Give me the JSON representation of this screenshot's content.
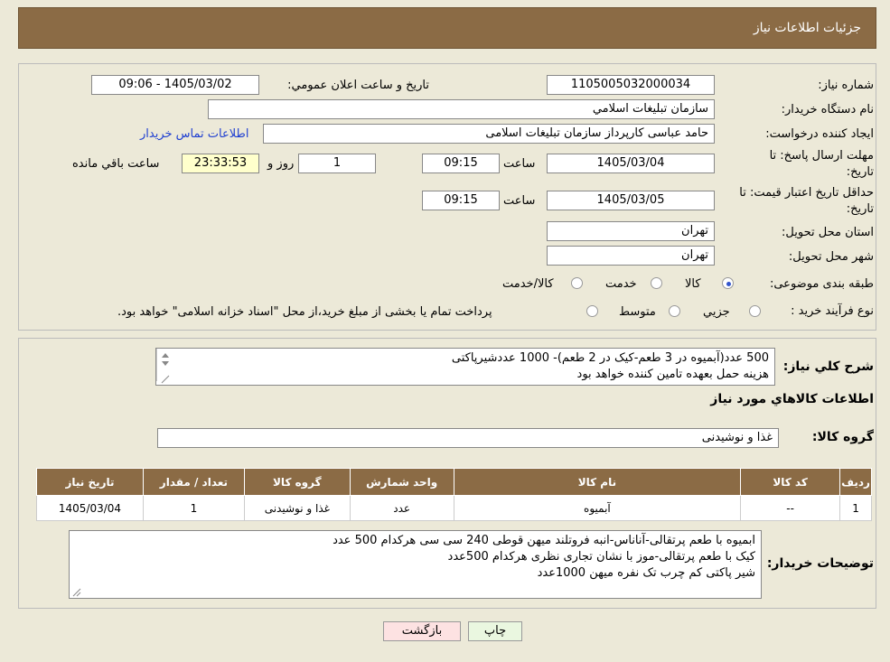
{
  "header": {
    "title": "جزئیات اطلاعات نیاز"
  },
  "fields": {
    "need_number_label": "شماره نیاز:",
    "need_number": "1105005032000034",
    "announce_label": "تاریخ و ساعت اعلان عمومي:",
    "announce_value": "1405/03/02 - 09:06",
    "buyer_label": "نام دستگاه خريدار:",
    "buyer_value": "سازمان تبليغات اسلامي",
    "creator_label": "ايجاد كننده درخواست:",
    "creator_value": "حامد عباسی کارپرداز سازمان تبلیغات اسلامی",
    "contact_link": "اطلاعات تماس خريدار",
    "deadline_label": "مهلت ارسال پاسخ: تا تاريخ:",
    "deadline_date": "1405/03/04",
    "time_label": "ساعت",
    "deadline_time": "09:15",
    "days_value": "1",
    "days_label": "روز و",
    "remaining_value": "23:33:53",
    "remaining_label": "ساعت باقي مانده",
    "validity_label": "حداقل تاريخ اعتبار قيمت: تا تاريخ:",
    "validity_date": "1405/03/05",
    "validity_time": "09:15",
    "province_label": "استان محل تحويل:",
    "province_value": "تهران",
    "city_label": "شهر محل تحويل:",
    "city_value": "تهران",
    "category_label": "طبقه بندی موضوعی:",
    "category_options": [
      "كالا",
      "خدمت",
      "كالا/خدمت"
    ],
    "process_label": "نوع فرآيند خريد :",
    "process_options": [
      "جزيي",
      "متوسط"
    ],
    "process_note": "پرداخت تمام يا بخشی از مبلغ خريد،از محل \"اسناد خزانه اسلامی\" خواهد بود."
  },
  "summary": {
    "label": "شرح كلي نياز:",
    "lines": [
      "500 عدد(آبمیوه در 3 طعم-کیک در 2 طعم)- 1000 عددشیرپاکتی",
      "هزینه حمل بعهده تامین کننده خواهد بود"
    ]
  },
  "goods": {
    "section_title": "اطلاعات كالاهاي مورد نياز",
    "group_label": "گروه كالا:",
    "group_value": "غذا و نوشيدنی",
    "columns": [
      "رديف",
      "كد كالا",
      "نام كالا",
      "واحد شمارش",
      "گروه كالا",
      "تعداد / مقدار",
      "تاريخ نياز"
    ],
    "rows": [
      [
        "1",
        "--",
        "آبمیوه",
        "عدد",
        "غذا و نوشيدنی",
        "1",
        "1405/03/04"
      ]
    ]
  },
  "buyer_notes": {
    "label": "توضيحات خريدار:",
    "lines": [
      "ابمیوه با طعم پرتقالی-آناناس-انبه فروتلند میهن قوطی 240 سی سی هرکدام 500 عدد",
      "کیک با طعم پرتقالی-موز با نشان تجاری نظری هرکدام 500عدد",
      "شیر پاکتی کم چرب تک نفره میهن 1000عدد"
    ]
  },
  "buttons": {
    "print": "چاپ",
    "back": "بازگشت"
  },
  "colors": {
    "header": "#8b6b45",
    "link": "#1f3fd1",
    "remaining_bg": "#ffffcc",
    "print_bg": "#eaf7e0",
    "back_bg": "#fde2e2"
  }
}
